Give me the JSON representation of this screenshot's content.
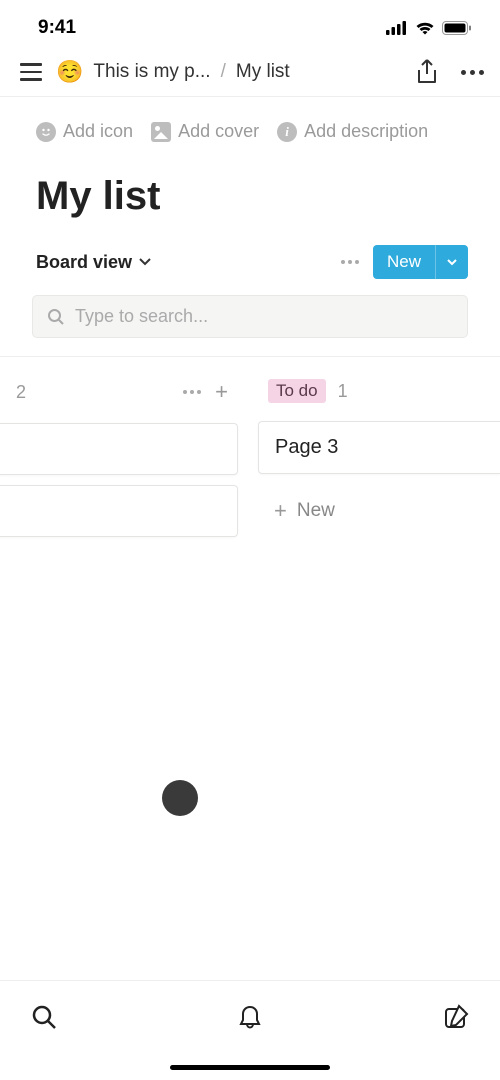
{
  "statusBar": {
    "time": "9:41"
  },
  "nav": {
    "parentEmoji": "☺️",
    "parentTitle": "This is my p...",
    "separator": "/",
    "currentTitle": "My list"
  },
  "pageActions": {
    "addIcon": "Add icon",
    "addCover": "Add cover",
    "addDescription": "Add description"
  },
  "page": {
    "title": "My list"
  },
  "viewBar": {
    "viewName": "Board view",
    "newLabel": "New"
  },
  "search": {
    "placeholder": "Type to search..."
  },
  "board": {
    "leftCol": {
      "count": "2"
    },
    "rightCol": {
      "label": "To do",
      "count": "1",
      "cards": [
        {
          "title": "Page 3"
        }
      ],
      "newLabel": "New"
    }
  }
}
